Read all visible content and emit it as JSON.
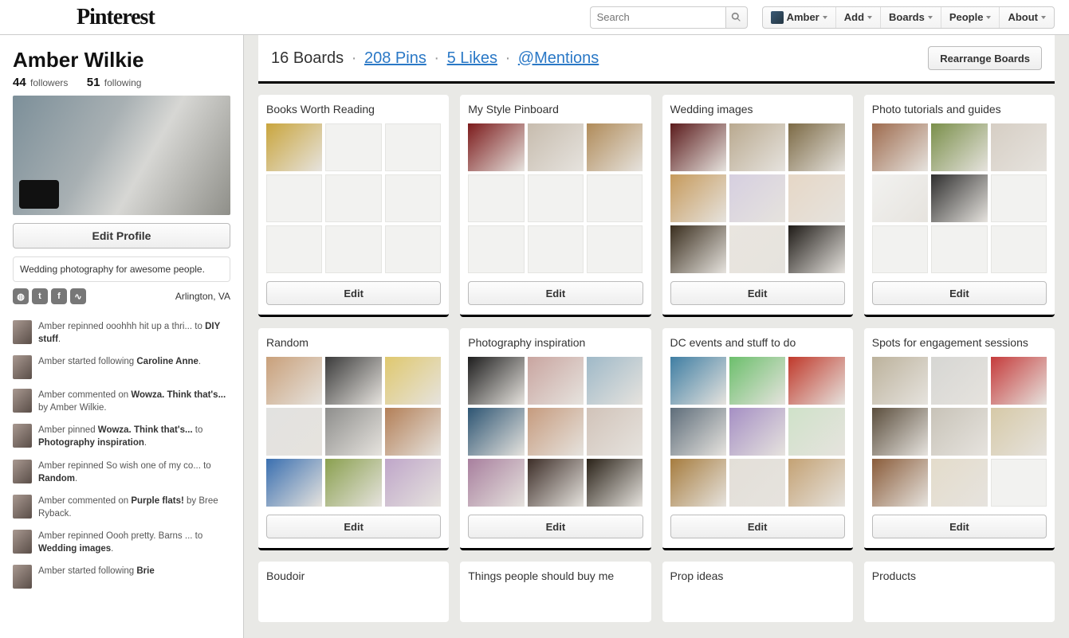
{
  "brand": "Pinterest",
  "search": {
    "placeholder": "Search"
  },
  "nav": {
    "user": "Amber",
    "add": "Add",
    "boards": "Boards",
    "people": "People",
    "about": "About"
  },
  "profile": {
    "name": "Amber Wilkie",
    "followers_count": "44",
    "followers_label": "followers",
    "following_count": "51",
    "following_label": "following",
    "edit_profile": "Edit Profile",
    "bio": "Wedding photography for awesome people.",
    "location": "Arlington, VA"
  },
  "activity": [
    {
      "text_pre": "Amber repinned ooohhh hit up a thri... to ",
      "bold": "DIY stuff",
      "text_post": "."
    },
    {
      "text_pre": "Amber started following ",
      "bold": "Caroline Anne",
      "text_post": "."
    },
    {
      "text_pre": "Amber commented on ",
      "bold": "Wowza. Think that's...",
      "text_post": " by Amber Wilkie."
    },
    {
      "text_pre": "Amber pinned ",
      "bold": "Wowza. Think that's...",
      "text_post": " to ",
      "bold2": "Photography inspiration",
      "text_post2": "."
    },
    {
      "text_pre": "Amber repinned So wish one of my co... to ",
      "bold": "Random",
      "text_post": "."
    },
    {
      "text_pre": "Amber commented on ",
      "bold": "Purple flats!",
      "text_post": " by Bree Ryback."
    },
    {
      "text_pre": "Amber repinned Oooh pretty. Barns ... to ",
      "bold": "Wedding images",
      "text_post": "."
    },
    {
      "text_pre": "Amber started following ",
      "bold": "Brie",
      "text_post": ""
    }
  ],
  "stats": {
    "boards_count": "16",
    "boards_label": "Boards",
    "pins": "208 Pins",
    "likes": "5 Likes",
    "mentions": "@Mentions",
    "rearrange": "Rearrange Boards"
  },
  "boards": [
    {
      "title": "Books Worth Reading",
      "thumbs": 9,
      "filled": [
        0
      ],
      "edit": "Edit",
      "palette": [
        "#c9a53d"
      ]
    },
    {
      "title": "My Style Pinboard",
      "thumbs": 9,
      "filled": [
        0,
        1,
        2
      ],
      "edit": "Edit",
      "palette": [
        "#7c1b1c",
        "#c7bcae",
        "#b08b59"
      ]
    },
    {
      "title": "Wedding images",
      "thumbs": 9,
      "filled": [
        0,
        1,
        2,
        3,
        4,
        5,
        6,
        7,
        8
      ],
      "edit": "Edit",
      "palette": [
        "#5b1b1c",
        "#b9a98f",
        "#7c6a45",
        "#c69a5c",
        "#d6cfe0",
        "#e6d7c6",
        "#3a2e1e",
        "#e9e5df",
        "#1f1b17"
      ]
    },
    {
      "title": "Photo tutorials and guides",
      "thumbs": 9,
      "filled": [
        0,
        1,
        2,
        3,
        4
      ],
      "edit": "Edit",
      "palette": [
        "#9e6b4e",
        "#7a8f4a",
        "#d6cec4",
        "#f2f2f0",
        "#2f2f2f"
      ]
    },
    {
      "title": "Random",
      "thumbs": 9,
      "filled": [
        0,
        1,
        2,
        3,
        4,
        5,
        6,
        7,
        8
      ],
      "edit": "Edit",
      "palette": [
        "#c9a07a",
        "#3b3b3b",
        "#dfc86e",
        "#e2e2e0",
        "#8e8e8c",
        "#b37f57",
        "#3a6fb0",
        "#8aa04f",
        "#bfa6c9"
      ]
    },
    {
      "title": "Photography inspiration",
      "thumbs": 9,
      "filled": [
        0,
        1,
        2,
        3,
        4,
        5,
        6,
        7,
        8
      ],
      "edit": "Edit",
      "palette": [
        "#1e1e1e",
        "#c9a5a0",
        "#9fb9c8",
        "#2d5573",
        "#c69b7e",
        "#d1c3b9",
        "#a87f9e",
        "#3d2e28",
        "#2a2218"
      ]
    },
    {
      "title": "DC events and stuff to do",
      "thumbs": 9,
      "filled": [
        0,
        1,
        2,
        3,
        4,
        5,
        6,
        7,
        8
      ],
      "edit": "Edit",
      "palette": [
        "#3f7ea3",
        "#6cbf6c",
        "#c0392b",
        "#5e6d7a",
        "#a58fc4",
        "#cfe2c9",
        "#a67c3e",
        "#e3dfd8",
        "#c4a274"
      ]
    },
    {
      "title": "Spots for engagement sessions",
      "thumbs": 9,
      "filled": [
        0,
        1,
        2,
        3,
        4,
        5,
        6,
        7
      ],
      "edit": "Edit",
      "palette": [
        "#bcb29c",
        "#d6d6d3",
        "#c53b3b",
        "#5b4e3d",
        "#c8c3b8",
        "#d6c9a7",
        "#8a5c3a",
        "#e4dccb"
      ]
    }
  ],
  "stub_boards": [
    {
      "title": "Boudoir"
    },
    {
      "title": "Things people should buy me"
    },
    {
      "title": "Prop ideas"
    },
    {
      "title": "Products"
    }
  ]
}
